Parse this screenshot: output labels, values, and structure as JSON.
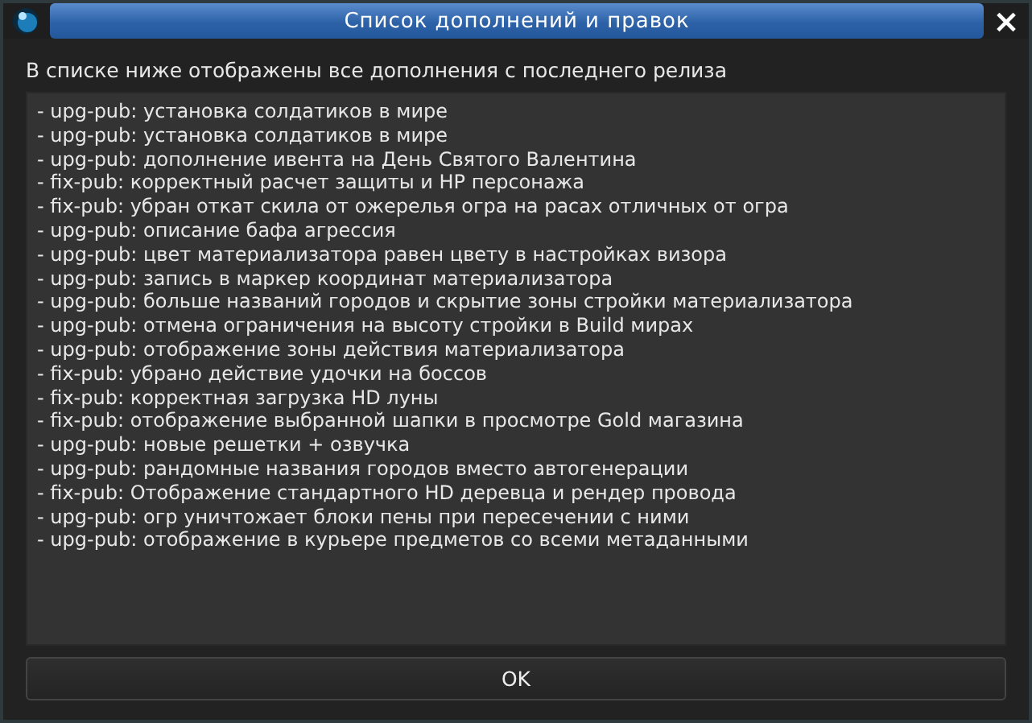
{
  "window": {
    "title": "Список дополнений и правок",
    "close": "×"
  },
  "description": "В списке ниже отображены все дополнения с последнего релиза",
  "changes": [
    "- upg-pub: установка солдатиков в мире",
    "- upg-pub: установка солдатиков в мире",
    "- upg-pub: дополнение ивента на День Святого Валентина",
    "- fix-pub: корректный расчет защиты и HP персонажа",
    "- fix-pub: убран откат скила от ожерелья огра на расах отличных от огра",
    "- upg-pub: описание бафа агрессия",
    "- upg-pub: цвет материализатора равен цвету в настройках визора",
    "- upg-pub: запись в маркер координат материализатора",
    "- upg-pub: больше названий городов и скрытие зоны стройки материализатора",
    "- upg-pub: отмена ограничения на высоту стройки в Build мирах",
    "- upg-pub: отображение зоны действия материализатора",
    "- fix-pub: убрано действие удочки на боссов",
    "- fix-pub: корректная загрузка HD луны",
    "- fix-pub: отображение выбранной шапки в просмотре Gold магазина",
    "- upg-pub: новые решетки + озвучка",
    "- upg-pub: рандомные названия городов вместо автогенерации",
    "- fix-pub: Отображение стандартного HD деревца и рендер провода",
    "- upg-pub: огр уничтожает блоки пены при пересечении с ними",
    "- upg-pub: отображение в курьере предметов со всеми метаданными"
  ],
  "buttons": [
    "OK"
  ]
}
